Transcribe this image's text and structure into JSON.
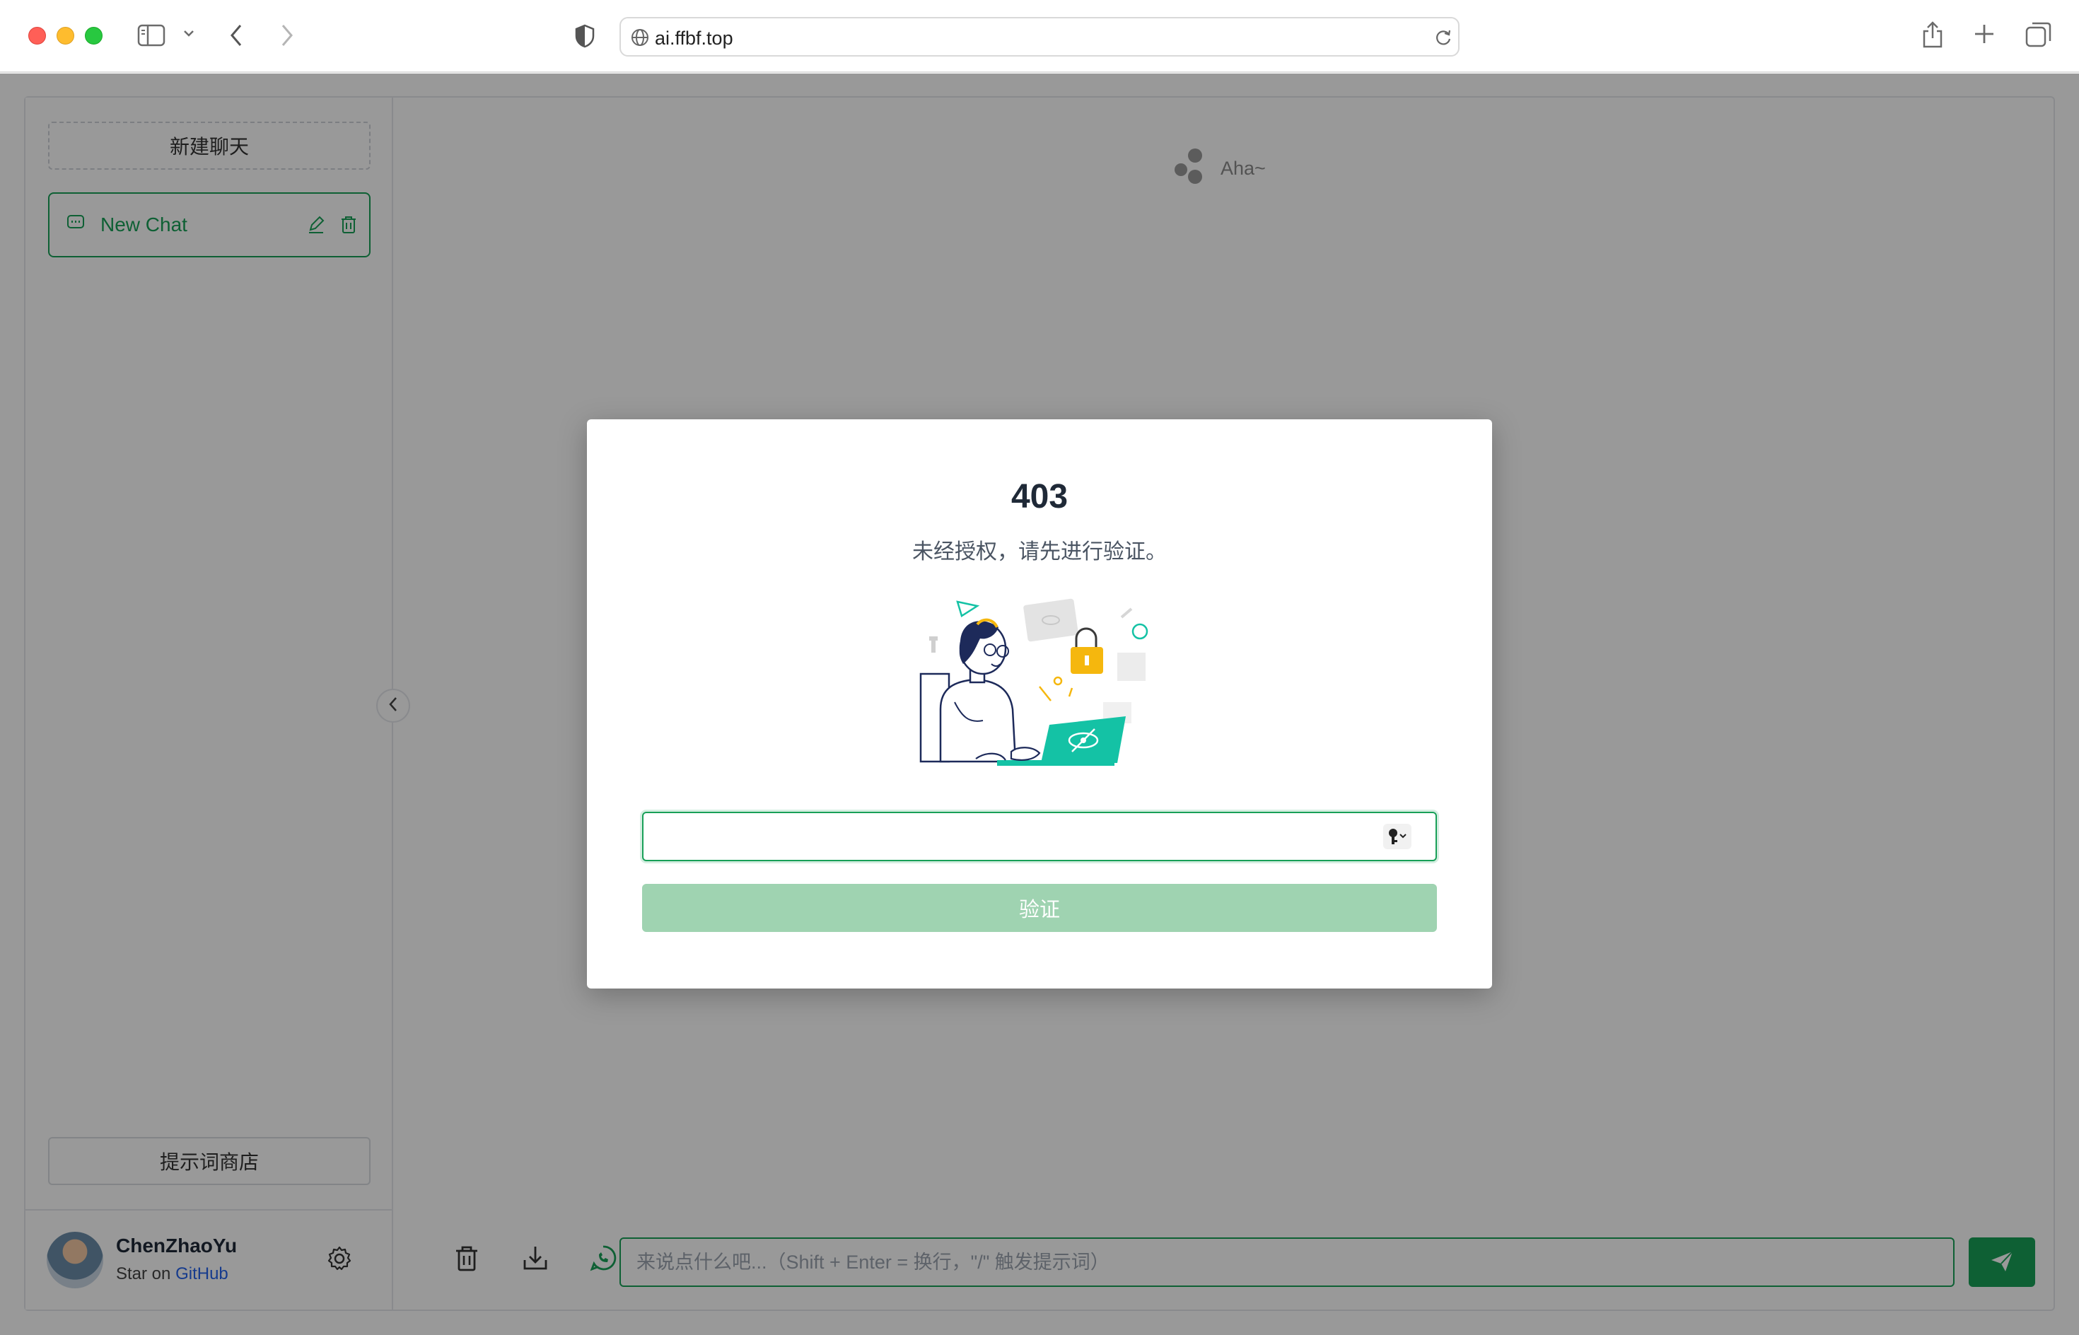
{
  "browser": {
    "url": "ai.ffbf.top"
  },
  "sidebar": {
    "new_chat_label": "新建聊天",
    "chats": [
      {
        "title": "New Chat",
        "active": true
      }
    ],
    "prompt_store_label": "提示词商店",
    "user": {
      "name": "ChenZhaoYu",
      "star_text": "Star on",
      "github_text": "GitHub"
    }
  },
  "main": {
    "empty_state_text": "Aha~",
    "input_placeholder": "来说点什么吧...（Shift + Enter = 换行，\"/\" 触发提示词）"
  },
  "modal": {
    "code": "403",
    "message": "未经授权，请先进行验证。",
    "key_input_value": "",
    "verify_label": "验证"
  },
  "colors": {
    "accent": "#18a058",
    "accent_disabled": "#9fd3b1",
    "overlay": "rgba(0,0,0,0.40)"
  },
  "icons": [
    "sidebar-toggle-icon",
    "chevron-down-icon",
    "back-icon",
    "forward-icon",
    "shield-icon",
    "globe-icon",
    "reload-icon",
    "share-icon",
    "new-tab-icon",
    "tabs-overview-icon",
    "chat-bubble-icon",
    "edit-icon",
    "trash-icon",
    "settings-icon",
    "chevron-left-icon",
    "export-icon",
    "history-icon",
    "send-icon",
    "key-icon"
  ]
}
